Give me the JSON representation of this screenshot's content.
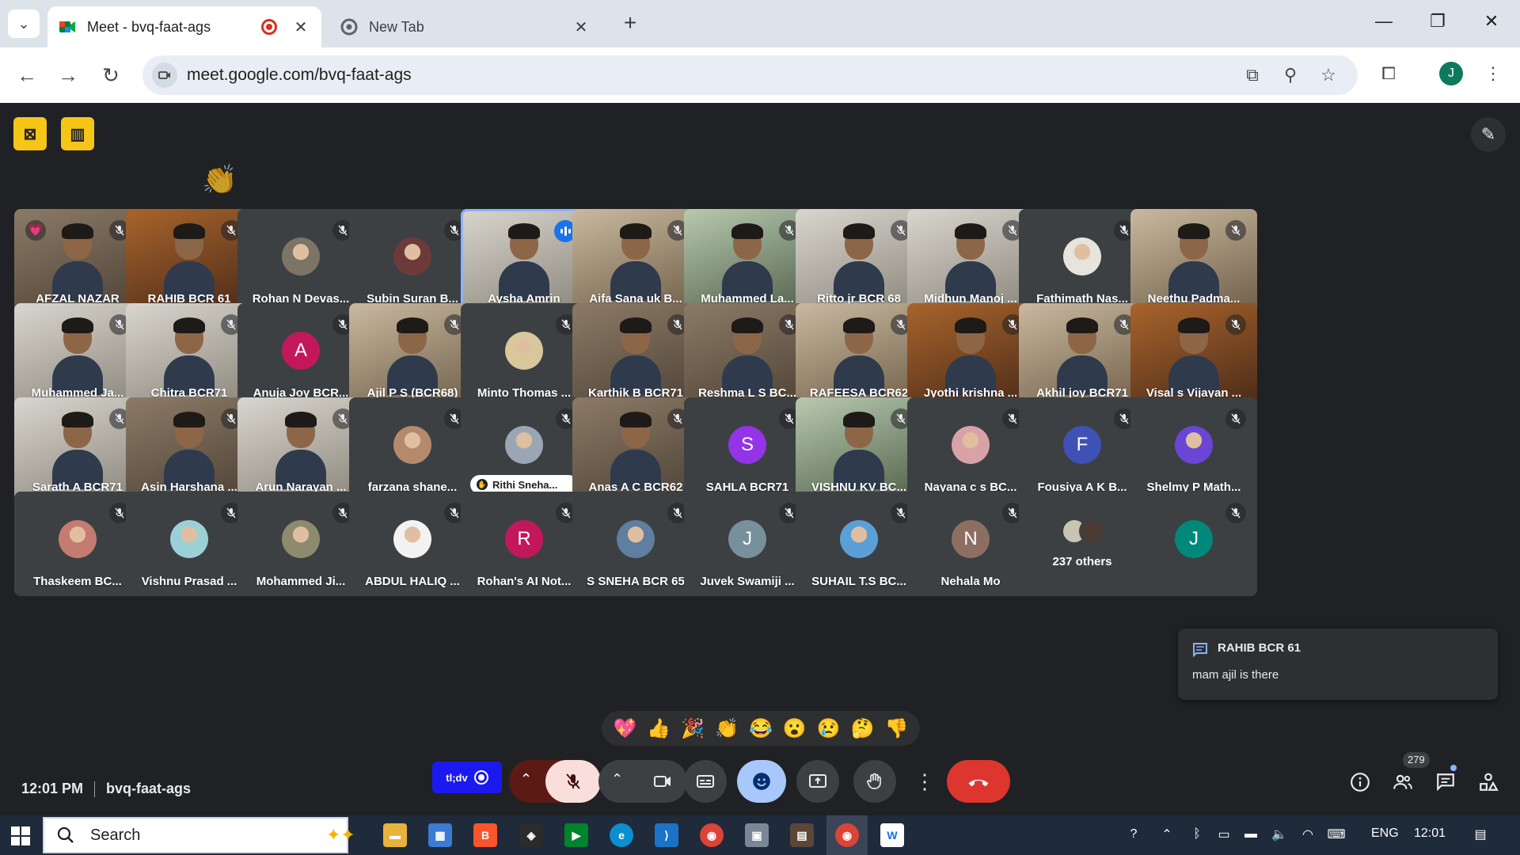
{
  "browser": {
    "tabs": [
      {
        "title": "Meet - bvq-faat-ags",
        "active": true
      },
      {
        "title": "New Tab",
        "active": false
      }
    ],
    "url": "meet.google.com/bvq-faat-ags",
    "profile_initial": "J"
  },
  "meet": {
    "time": "12:01 PM",
    "meeting_code": "bvq-faat-ags",
    "participants": [
      {
        "name": "AFZAL NAZAR",
        "kind": "video",
        "style": "v1",
        "heart": true
      },
      {
        "name": "RAHIB BCR 61",
        "kind": "video",
        "style": "v5"
      },
      {
        "name": "Rohan N Devas...",
        "kind": "photo",
        "color": "#7c7466"
      },
      {
        "name": "Subin Suran B...",
        "kind": "photo",
        "color": "#6d3a3a"
      },
      {
        "name": "Aysha Amrin",
        "kind": "video",
        "style": "v4",
        "speaking": true
      },
      {
        "name": "Aifa Sana uk B...",
        "kind": "video",
        "style": "v2"
      },
      {
        "name": "Muhammed La...",
        "kind": "video",
        "style": "v3"
      },
      {
        "name": "Ritto jr BCR 68",
        "kind": "video",
        "style": "v4"
      },
      {
        "name": "Midhun Manoj ...",
        "kind": "video",
        "style": "v4"
      },
      {
        "name": "Fathimath Nas...",
        "kind": "photo",
        "color": "#e7e3dd"
      },
      {
        "name": "Neethu Padma...",
        "kind": "video",
        "style": "v2"
      },
      {
        "name": "Muhammed Ja...",
        "kind": "video",
        "style": "v4"
      },
      {
        "name": "Chitra BCR71",
        "kind": "video",
        "style": "v4"
      },
      {
        "name": "Anuja Joy BCR...",
        "kind": "letter",
        "letter": "A",
        "color": "#c2185b"
      },
      {
        "name": "Ajil P S (BCR68)",
        "kind": "video",
        "style": "v2"
      },
      {
        "name": "Minto Thomas ...",
        "kind": "photo",
        "color": "#d9c79c"
      },
      {
        "name": "Karthik B BCR71",
        "kind": "video",
        "style": "v1"
      },
      {
        "name": "Reshma L S BC...",
        "kind": "video",
        "style": "v1"
      },
      {
        "name": "RAFEESA BCR62",
        "kind": "video",
        "style": "v2"
      },
      {
        "name": "Jyothi krishna ...",
        "kind": "video",
        "style": "v5"
      },
      {
        "name": "Akhil joy BCR71",
        "kind": "video",
        "style": "v2"
      },
      {
        "name": "Visal s Vijayan ...",
        "kind": "video",
        "style": "v5"
      },
      {
        "name": "Sarath A BCR71",
        "kind": "video",
        "style": "v4"
      },
      {
        "name": "Asin Harshana ...",
        "kind": "video",
        "style": "v1"
      },
      {
        "name": "Arun Narayan ...",
        "kind": "video",
        "style": "v4"
      },
      {
        "name": "farzana shane...",
        "kind": "photo",
        "color": "#b58a6c"
      },
      {
        "name": "Rithi Sneha...",
        "kind": "photo",
        "color": "#9aa6b4",
        "pill": true
      },
      {
        "name": "Anas A C BCR62",
        "kind": "video",
        "style": "v1"
      },
      {
        "name": "SAHLA BCR71",
        "kind": "letter",
        "letter": "S",
        "color": "#9334e6"
      },
      {
        "name": "VISHNU KV BC...",
        "kind": "video",
        "style": "v3"
      },
      {
        "name": "Nayana c s BC...",
        "kind": "photo",
        "color": "#d8a2a8"
      },
      {
        "name": "Fousiya A K B...",
        "kind": "letter",
        "letter": "F",
        "color": "#3f51b5"
      },
      {
        "name": "Shelmy P Math...",
        "kind": "photo",
        "color": "#6a45d6"
      },
      {
        "name": "Thaskeem BC...",
        "kind": "photo",
        "color": "#c47b72"
      },
      {
        "name": "Vishnu Prasad ...",
        "kind": "photo",
        "color": "#9bd1d6"
      },
      {
        "name": "Mohammed Ji...",
        "kind": "photo",
        "color": "#8d8a6e"
      },
      {
        "name": "ABDUL HALIQ ...",
        "kind": "photo",
        "color": "#f2f2f2"
      },
      {
        "name": "Rohan's AI Not...",
        "kind": "letter",
        "letter": "R",
        "color": "#c2185b"
      },
      {
        "name": "S SNEHA BCR 65",
        "kind": "photo",
        "color": "#5f7ea0"
      },
      {
        "name": "Juvek Swamiji ...",
        "kind": "letter",
        "letter": "J",
        "color": "#78909c"
      },
      {
        "name": "SUHAIL T.S BC...",
        "kind": "photo",
        "color": "#5aa0d6"
      },
      {
        "name": "Nehala Mo",
        "kind": "letter",
        "letter": "N",
        "color": "#8d6e63"
      },
      {
        "name": "",
        "kind": "others"
      },
      {
        "name": "",
        "kind": "letter",
        "letter": "J",
        "color": "#00897b"
      }
    ],
    "others_label": "237 others",
    "chat_toast": {
      "sender": "RAHIB BCR 61",
      "message": "mam ajil is there"
    },
    "reactions": [
      "💖",
      "👍",
      "🎉",
      "👏",
      "😂",
      "😮",
      "😢",
      "🤔",
      "👎"
    ],
    "tldv_label": "tl;dv",
    "participant_count": "279"
  },
  "taskbar": {
    "search_placeholder": "Search",
    "language": "ENG",
    "clock": "12:01"
  }
}
